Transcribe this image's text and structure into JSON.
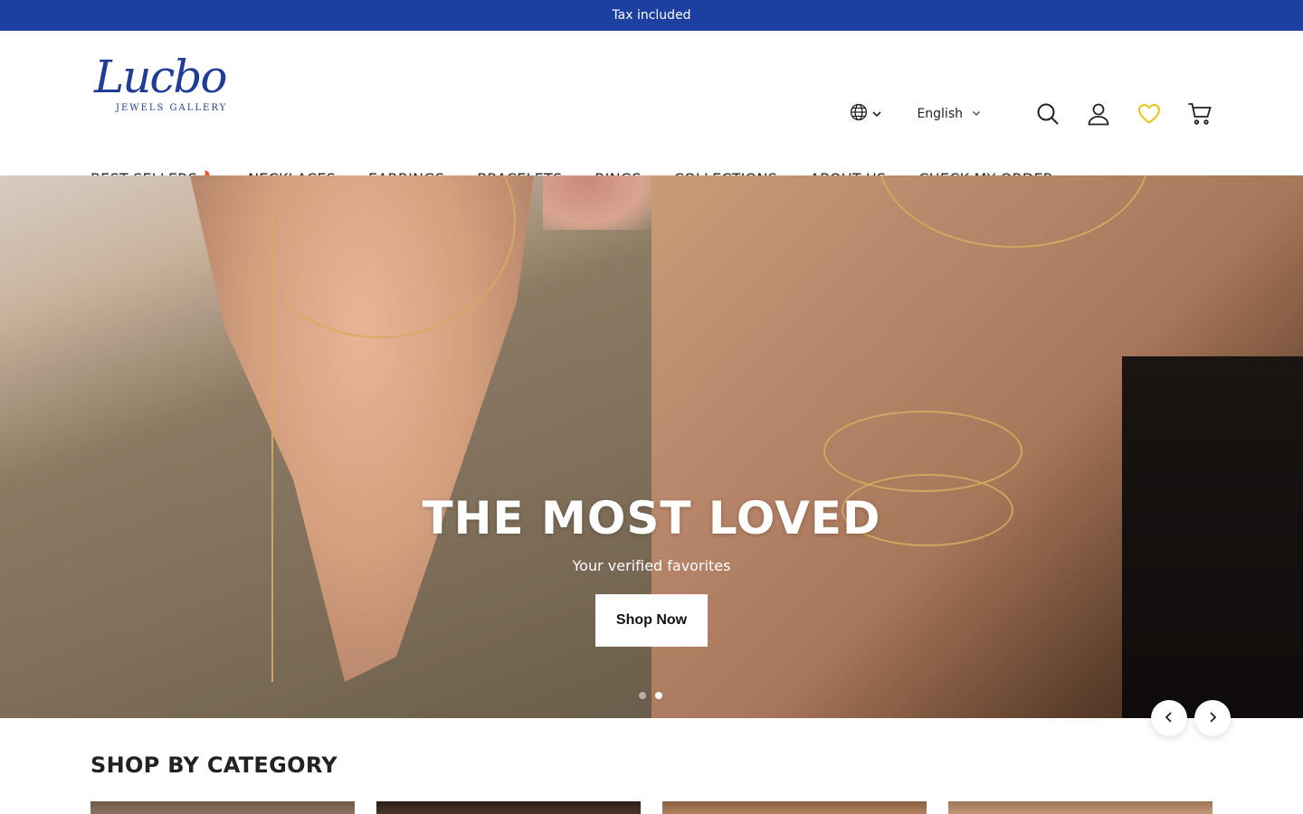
{
  "announcement": "Tax included",
  "brand": {
    "script": "Lucbo",
    "subtitle": "JEWELS GALLERY",
    "color": "#1f3c96"
  },
  "header": {
    "country_icon": "globe-icon",
    "language": "English",
    "icons": [
      "search-icon",
      "account-icon",
      "wishlist-heart-icon",
      "cart-icon"
    ]
  },
  "nav": {
    "items": [
      "BEST SELLERS🔥",
      "NECKLACES",
      "EARRINGS",
      "BRACELETS",
      "RINGS",
      "COLLECTIONS",
      "ABOUT US",
      "CHECK MY ORDER"
    ]
  },
  "hero": {
    "title": "THE MOST LOVED",
    "subtitle": "Your verified favorites",
    "button": "Shop Now",
    "slides": 2,
    "active_slide": 2
  },
  "category": {
    "title": "SHOP BY CATEGORY"
  },
  "colors": {
    "announcement_bg": "#1c3fa0",
    "wishlist": "#e8c21e"
  }
}
